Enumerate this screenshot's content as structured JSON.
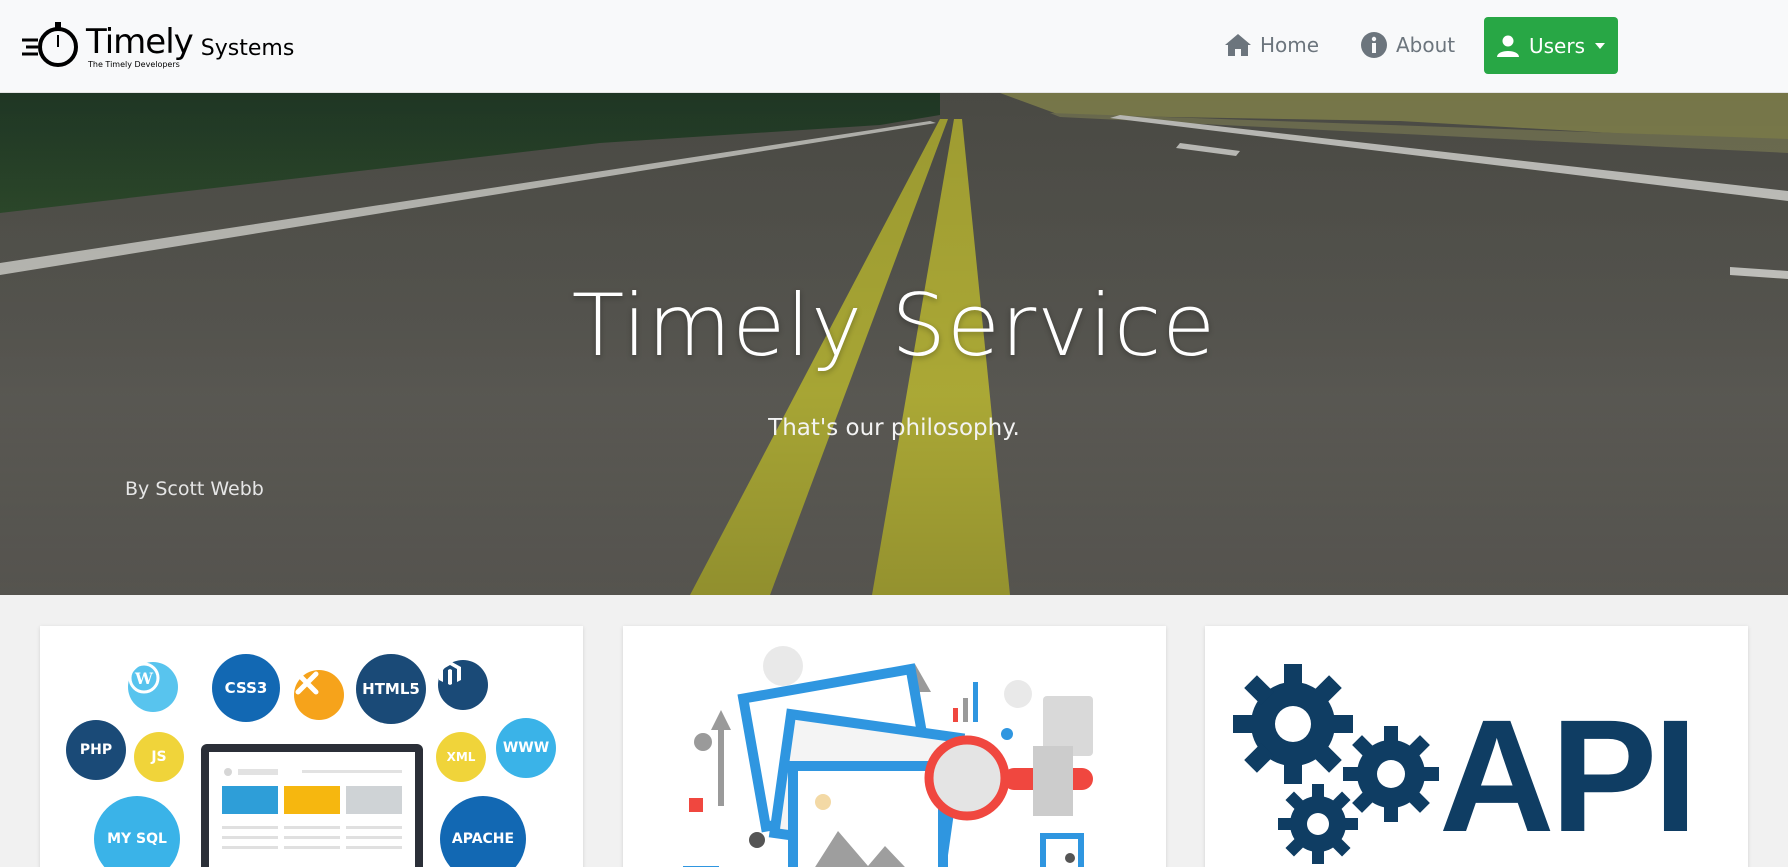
{
  "brand": {
    "name": "Timely",
    "suffix": "Systems",
    "tagline": "The Timely Developers",
    "logo_icon": "stopwatch-icon"
  },
  "nav": {
    "home_label": "Home",
    "home_icon": "home-icon",
    "about_label": "About",
    "about_icon": "info-icon",
    "users_label": "Users",
    "users_icon": "user-icon",
    "users_color": "#28a745"
  },
  "hero": {
    "title": "Timely Service",
    "subtitle": "That's our philosophy.",
    "credit": "By Scott Webb"
  },
  "cards": {
    "web": {
      "bubbles": [
        "CSS3",
        "HTML5",
        "PHP",
        "JS",
        "XML",
        "WWW",
        "MY SQL",
        "APACHE"
      ]
    },
    "api": {
      "label": "API",
      "color": "#0f3d63"
    }
  }
}
